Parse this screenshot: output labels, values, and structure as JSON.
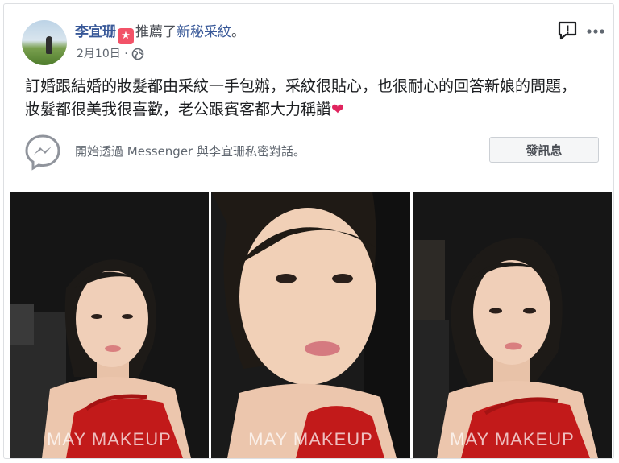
{
  "post": {
    "author": "李宜珊",
    "badge_icon": "star-badge-icon",
    "action_text": "推薦了",
    "page_name": "新秘采紋",
    "period": "。",
    "date": "2月10日",
    "separator": "·",
    "privacy_icon": "globe-icon",
    "body_text": "訂婚跟結婚的妝髮都由采紋一手包辦，采紋很貼心，也很耐心的回答新娘的問題，妝髮都很美我很喜歡，老公跟賓客都大力稱讚",
    "heart": "❤"
  },
  "header_actions": {
    "report_icon": "report-icon",
    "more_icon": "more-options-icon"
  },
  "messenger": {
    "prompt": "開始透過 Messenger 與李宜珊私密對話。",
    "button_label": "發訊息",
    "icon": "messenger-icon"
  },
  "photos": [
    {
      "watermark": "MAY MAKEUP"
    },
    {
      "watermark": "MAY MAKEUP"
    },
    {
      "watermark": "MAY MAKEUP"
    }
  ],
  "colors": {
    "link": "#385898",
    "badge": "#f25268",
    "dress": "#c21a1a",
    "heart": "#e0245e"
  }
}
